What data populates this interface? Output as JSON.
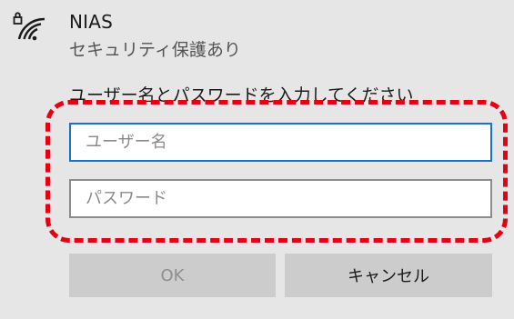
{
  "network": {
    "ssid": "NIAS",
    "security": "セキュリティ保護あり",
    "icon": "secured-wifi-icon"
  },
  "login": {
    "prompt": "ユーザー名とパスワードを入力してください",
    "username_placeholder": "ユーザー名",
    "username_value": "",
    "password_placeholder": "パスワード",
    "password_value": ""
  },
  "buttons": {
    "ok_label": "OK",
    "cancel_label": "キャンセル"
  },
  "colors": {
    "highlight_frame": "#e60012",
    "focus_border": "#1e6fc9"
  }
}
